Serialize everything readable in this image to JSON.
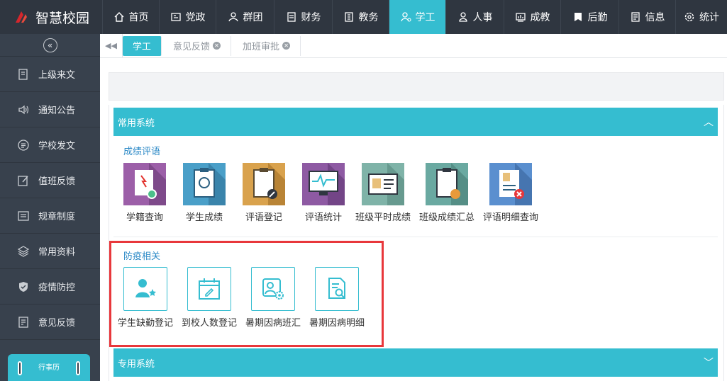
{
  "app": {
    "title": "智慧校园"
  },
  "nav": [
    {
      "label": "首页",
      "icon": "home-icon"
    },
    {
      "label": "党政",
      "icon": "badge-icon"
    },
    {
      "label": "群团",
      "icon": "users-icon"
    },
    {
      "label": "财务",
      "icon": "clipboard-icon"
    },
    {
      "label": "教务",
      "icon": "building-icon"
    },
    {
      "label": "学工",
      "icon": "student-icon",
      "active": true
    },
    {
      "label": "人事",
      "icon": "person-icon"
    },
    {
      "label": "成教",
      "icon": "chart-icon"
    },
    {
      "label": "后勤",
      "icon": "bookmark-icon"
    },
    {
      "label": "信息",
      "icon": "info-icon"
    },
    {
      "label": "统计",
      "icon": "gear-icon"
    }
  ],
  "sidebar": {
    "items": [
      {
        "label": "上级来文"
      },
      {
        "label": "通知公告"
      },
      {
        "label": "学校发文"
      },
      {
        "label": "值班反馈"
      },
      {
        "label": "规章制度"
      },
      {
        "label": "常用资料"
      },
      {
        "label": "疫情防控"
      },
      {
        "label": "意见反馈"
      }
    ],
    "calendar_label": "行事历"
  },
  "tabs": [
    {
      "label": "学工",
      "active": true
    },
    {
      "label": "意见反馈"
    },
    {
      "label": "加班审批"
    }
  ],
  "sections": {
    "common": {
      "title": "常用系统"
    },
    "special": {
      "title": "专用系统"
    }
  },
  "groups": {
    "grades": {
      "title": "成绩评语",
      "apps": [
        {
          "label": "学籍查询",
          "color": "#9c5fa8"
        },
        {
          "label": "学生成绩",
          "color": "#4a9fc8"
        },
        {
          "label": "评语登记",
          "color": "#d9a24d"
        },
        {
          "label": "评语统计",
          "color": "#8e5aa3"
        },
        {
          "label": "班级平时成绩",
          "color": "#7fb3a8"
        },
        {
          "label": "班级成绩汇总",
          "color": "#6aa9a1"
        },
        {
          "label": "评语明细查询",
          "color": "#5a8fcf"
        }
      ]
    },
    "epidemic": {
      "title": "防疫相关",
      "apps": [
        {
          "label": "学生缺勤登记"
        },
        {
          "label": "到校人数登记"
        },
        {
          "label": "暑期因病班汇"
        },
        {
          "label": "暑期因病明细"
        }
      ]
    }
  },
  "colors": {
    "accent": "#35bdd0",
    "topbar": "#2f3640",
    "sidebar": "#38414d",
    "highlight": "#e8373b"
  }
}
